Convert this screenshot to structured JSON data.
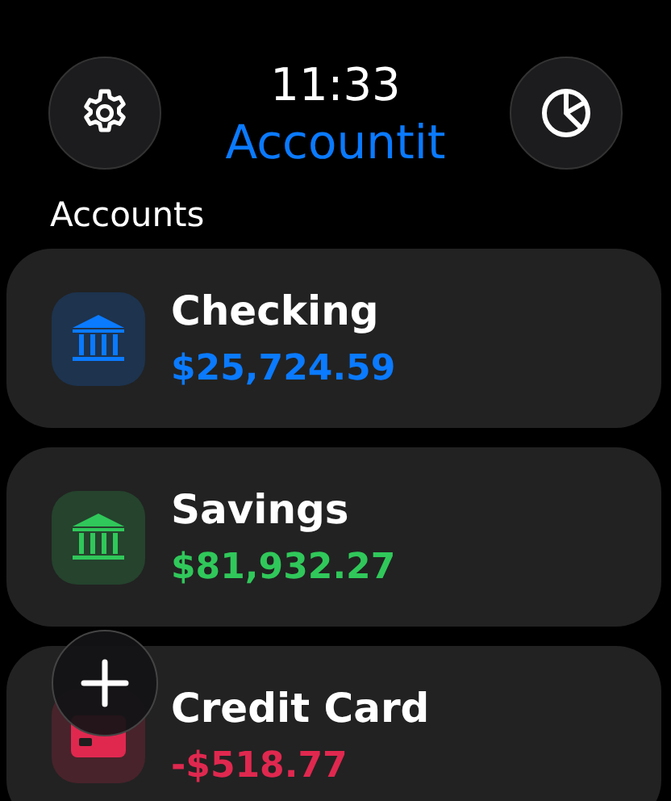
{
  "header": {
    "time": "11:33",
    "title": "Accountit"
  },
  "section_title": "Accounts",
  "accounts": [
    {
      "name": "Checking",
      "amount": "$25,724.59",
      "kind": "bank",
      "color": "#0a7aff"
    },
    {
      "name": "Savings",
      "amount": "$81,932.27",
      "kind": "bank",
      "color": "#30c85a"
    },
    {
      "name": "Credit Card",
      "amount": "-$518.77",
      "kind": "card",
      "color": "#e0284f"
    }
  ]
}
